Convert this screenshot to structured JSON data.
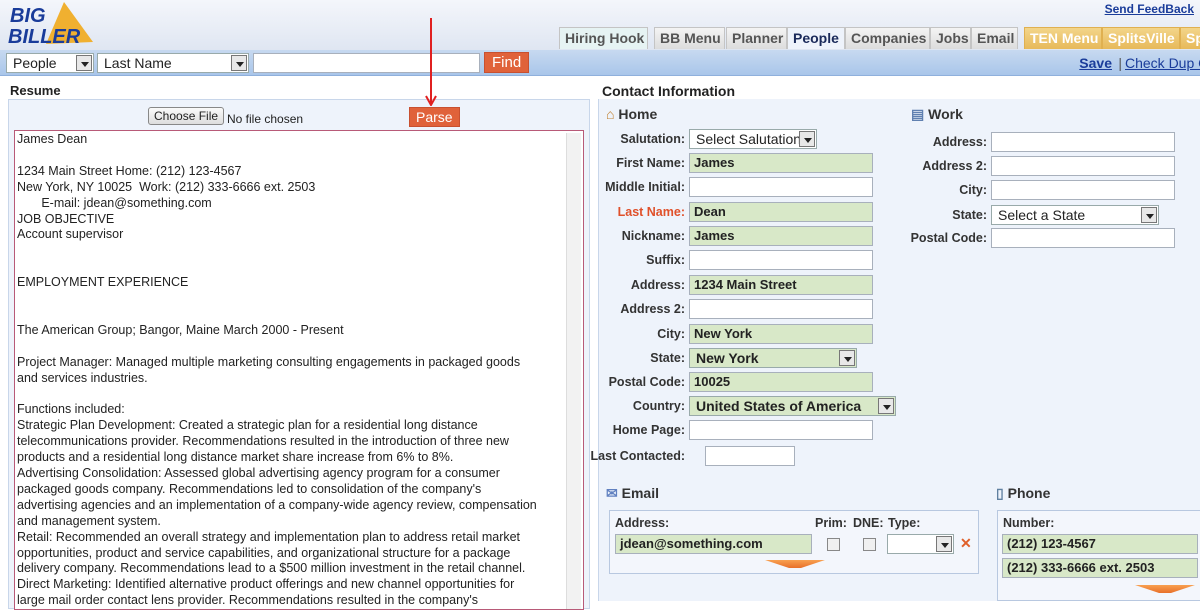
{
  "header": {
    "logo": "BIG BILLER",
    "feedback": "Send FeedBack",
    "tabs": [
      "Hiring Hook",
      "BB Menu",
      "Planner",
      "People",
      "Companies",
      "Jobs",
      "Email",
      "TEN Menu",
      "SplitsVille",
      "Sp"
    ]
  },
  "search": {
    "entity": "People",
    "field": "Last Name",
    "query": "",
    "find": "Find"
  },
  "actions": {
    "save": "Save",
    "sep": "|",
    "check_dup": "Check Dup C"
  },
  "resume": {
    "title": "Resume",
    "choose_file": "Choose File",
    "no_file": "No file chosen",
    "parse": "Parse",
    "text": "James Dean\n\n1234 Main Street Home: (212) 123-4567\nNew York, NY 10025  Work: (212) 333-6666 ext. 2503\n       E-mail: jdean@something.com\nJOB OBJECTIVE\nAccount supervisor\n\n\nEMPLOYMENT EXPERIENCE\n\n\nThe American Group; Bangor, Maine March 2000 - Present\n\nProject Manager: Managed multiple marketing consulting engagements in packaged goods\nand services industries.\n\nFunctions included:\nStrategic Plan Development: Created a strategic plan for a residential long distance\ntelecommunications provider. Recommendations resulted in the introduction of three new\nproducts and a residential long distance market share increase from 6% to 8%.\nAdvertising Consolidation: Assessed global advertising agency program for a consumer\npackaged goods company. Recommendations led to consolidation of the company's\nadvertising agencies and an implementation of a company-wide agency review, compensation\nand management system.\nRetail: Recommended an overall strategy and implementation plan to address retail market\nopportunities, product and service capabilities, and organizational structure for a package\ndelivery company. Recommendations lead to a $500 million investment in the retail channel.\nDirect Marketing: Identified alternative product offerings and new channel opportunities for\nlarge mail order contact lens provider. Recommendations resulted in the company's"
  },
  "contact": {
    "title": "Contact Information",
    "home": {
      "title": "Home",
      "fields": [
        {
          "label": "Salutation:",
          "value": "Select Salutation",
          "type": "select"
        },
        {
          "label": "First Name:",
          "value": "James",
          "filled": true
        },
        {
          "label": "Middle Initial:",
          "value": ""
        },
        {
          "label": "Last Name:",
          "value": "Dean",
          "filled": true,
          "required": true
        },
        {
          "label": "Nickname:",
          "value": "James",
          "filled": true
        },
        {
          "label": "Suffix:",
          "value": ""
        },
        {
          "label": "Address:",
          "value": "1234 Main Street",
          "filled": true
        },
        {
          "label": "Address 2:",
          "value": ""
        },
        {
          "label": "City:",
          "value": "New York",
          "filled": true
        },
        {
          "label": "State:",
          "value": "New York",
          "filled": true,
          "type": "select"
        },
        {
          "label": "Postal Code:",
          "value": "10025",
          "filled": true
        },
        {
          "label": "Country:",
          "value": "United States of America",
          "filled": true,
          "type": "select"
        },
        {
          "label": "Home Page:",
          "value": ""
        },
        {
          "label": "Last Contacted:",
          "value": ""
        }
      ]
    },
    "work": {
      "title": "Work",
      "fields": [
        {
          "label": "Address:",
          "value": ""
        },
        {
          "label": "Address 2:",
          "value": ""
        },
        {
          "label": "City:",
          "value": ""
        },
        {
          "label": "State:",
          "value": "Select a State",
          "type": "select"
        },
        {
          "label": "Postal Code:",
          "value": ""
        }
      ]
    },
    "email": {
      "title": "Email",
      "address_label": "Address:",
      "prim_label": "Prim:",
      "dne_label": "DNE:",
      "type_label": "Type:",
      "address": "jdean@something.com"
    },
    "phone": {
      "title": "Phone",
      "number_label": "Number:",
      "numbers": [
        "(212) 123-4567",
        "(212) 333-6666 ext. 2503"
      ]
    }
  },
  "colors": {
    "accent": "#e0623a",
    "filled": "#d8e8c8",
    "link": "#1a3c9a"
  }
}
